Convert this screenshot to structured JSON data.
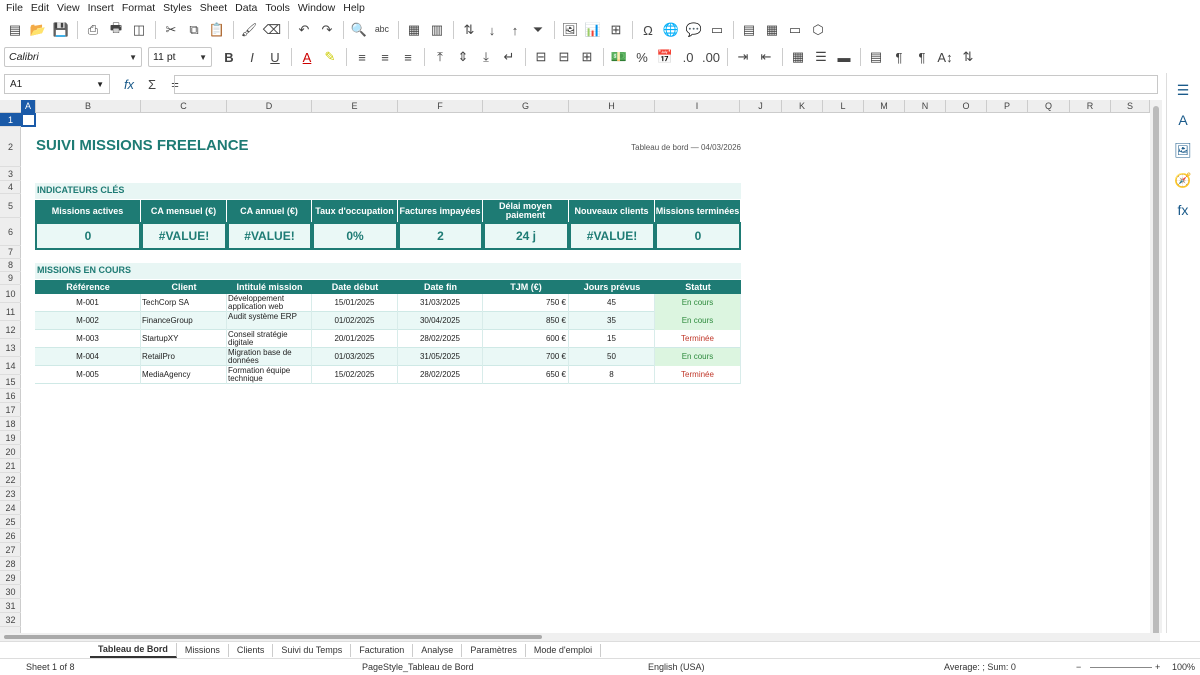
{
  "menu": [
    "File",
    "Edit",
    "View",
    "Insert",
    "Format",
    "Styles",
    "Sheet",
    "Data",
    "Tools",
    "Window",
    "Help"
  ],
  "font_name": "Calibri",
  "font_size": "11 pt",
  "name_box": "A1",
  "formula_symbols": {
    "fx": "fx",
    "sigma": "Σ",
    "eq": "="
  },
  "columns": [
    "A",
    "B",
    "C",
    "D",
    "E",
    "F",
    "G",
    "H",
    "I",
    "J",
    "K",
    "L",
    "M",
    "N",
    "O",
    "P",
    "Q",
    "R",
    "S"
  ],
  "rows": [
    "1",
    "2",
    "3",
    "4",
    "5",
    "6",
    "7",
    "8",
    "9",
    "10",
    "11",
    "12",
    "13",
    "14",
    "15",
    "16",
    "17",
    "18",
    "19",
    "20",
    "21",
    "22",
    "23",
    "24",
    "25",
    "26",
    "27",
    "28",
    "29",
    "30",
    "31",
    "32"
  ],
  "sheet": {
    "title": "SUIVI MISSIONS FREELANCE",
    "subtitle": "Tableau de bord — 04/03/2026",
    "kpi_section": "INDICATEURS CLÉS",
    "kpi_headers": [
      "Missions actives",
      "CA mensuel (€)",
      "CA annuel (€)",
      "Taux d'occupation",
      "Factures impayées",
      "Délai moyen paiement",
      "Nouveaux clients",
      "Missions terminées"
    ],
    "kpi_values": [
      "0",
      "#VALUE!",
      "#VALUE!",
      "0%",
      "2",
      "24 j",
      "#VALUE!",
      "0"
    ],
    "missions_section": "MISSIONS EN COURS",
    "table_headers": [
      "Référence",
      "Client",
      "Intitulé mission",
      "Date début",
      "Date fin",
      "TJM (€)",
      "Jours prévus",
      "Statut"
    ],
    "table_rows": [
      [
        "M-001",
        "TechCorp SA",
        "Développement application web",
        "15/01/2025",
        "31/03/2025",
        "750 €",
        "45",
        "En cours"
      ],
      [
        "M-002",
        "FinanceGroup",
        "Audit système ERP",
        "01/02/2025",
        "30/04/2025",
        "850 €",
        "35",
        "En cours"
      ],
      [
        "M-003",
        "StartupXY",
        "Conseil stratégie digitale",
        "20/01/2025",
        "28/02/2025",
        "600 €",
        "15",
        "Terminée"
      ],
      [
        "M-004",
        "RetailPro",
        "Migration base de données",
        "01/03/2025",
        "31/05/2025",
        "700 €",
        "50",
        "En cours"
      ],
      [
        "M-005",
        "MediaAgency",
        "Formation équipe technique",
        "15/02/2025",
        "28/02/2025",
        "650 €",
        "8",
        "Terminée"
      ]
    ]
  },
  "tabs": [
    "Tableau de Bord",
    "Missions",
    "Clients",
    "Suivi du Temps",
    "Facturation",
    "Analyse",
    "Paramètres",
    "Mode d'emploi"
  ],
  "status": {
    "sheet": "Sheet 1 of 8",
    "page_style": "PageStyle_Tableau de Bord",
    "language": "English (USA)",
    "summary": "Average: ; Sum: 0",
    "zoom": "100%"
  },
  "colors": {
    "accent": "#1e7b74",
    "light": "#eaf8f6",
    "green": "#2e8b3d",
    "red": "#c0392b"
  }
}
